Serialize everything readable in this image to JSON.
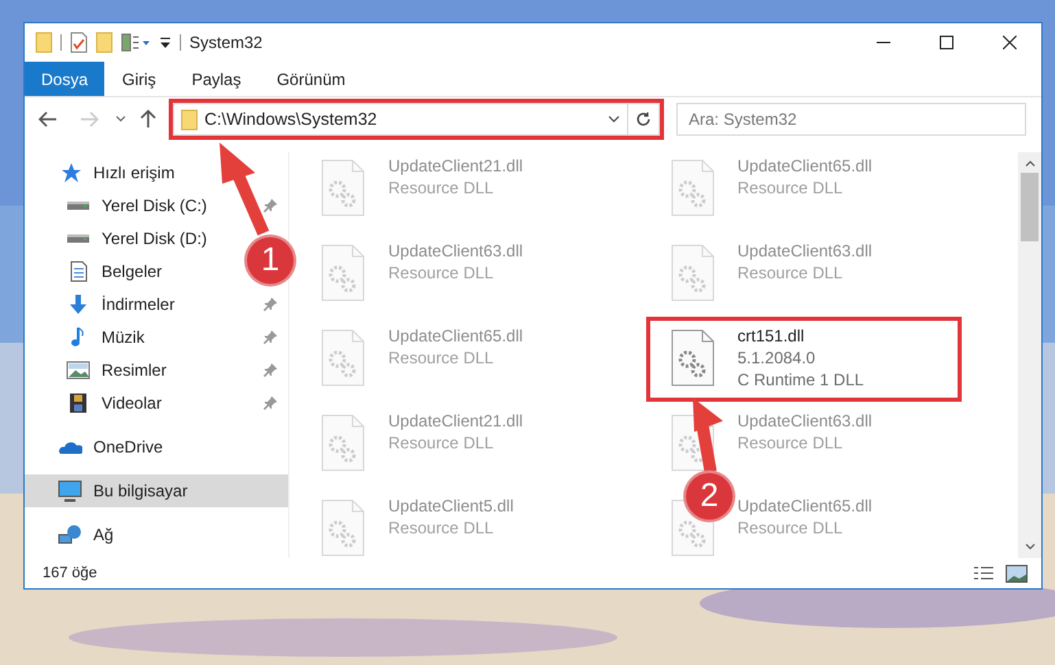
{
  "window": {
    "title": "System32"
  },
  "ribbon_tabs": [
    {
      "label": "Dosya",
      "selected": true
    },
    {
      "label": "Giriş",
      "selected": false
    },
    {
      "label": "Paylaş",
      "selected": false
    },
    {
      "label": "Görünüm",
      "selected": false
    }
  ],
  "address": {
    "value": "C:\\Windows\\System32"
  },
  "search": {
    "placeholder": "Ara: System32"
  },
  "sidebar": {
    "items": [
      {
        "label": "Hızlı erişim",
        "kind": "quick",
        "selected": false,
        "children": [
          {
            "label": "Yerel Disk (C:)",
            "kind": "disk",
            "pinned": true,
            "selected": false
          },
          {
            "label": "Yerel Disk (D:)",
            "kind": "disk",
            "pinned": false,
            "selected": false
          },
          {
            "label": "Belgeler",
            "kind": "docs",
            "pinned": false,
            "selected": false
          },
          {
            "label": "İndirmeler",
            "kind": "download",
            "pinned": true,
            "selected": false
          },
          {
            "label": "Müzik",
            "kind": "music",
            "pinned": true,
            "selected": false
          },
          {
            "label": "Resimler",
            "kind": "pictures",
            "pinned": true,
            "selected": false
          },
          {
            "label": "Videolar",
            "kind": "videos",
            "pinned": true,
            "selected": false
          }
        ]
      },
      {
        "label": "OneDrive",
        "kind": "cloud",
        "selected": false
      },
      {
        "label": "Bu bilgisayar",
        "kind": "pc",
        "selected": true
      },
      {
        "label": "Ağ",
        "kind": "network",
        "selected": false
      }
    ]
  },
  "files": [
    {
      "name": "UpdateClient21.dll",
      "lines": [
        "Resource DLL"
      ],
      "dimmed": true
    },
    {
      "name": "UpdateClient65.dll",
      "lines": [
        "Resource DLL"
      ],
      "dimmed": true
    },
    {
      "name": "UpdateClient63.dll",
      "lines": [
        "Resource DLL"
      ],
      "dimmed": true
    },
    {
      "name": "UpdateClient63.dll",
      "lines": [
        "Resource DLL"
      ],
      "dimmed": true
    },
    {
      "name": "UpdateClient65.dll",
      "lines": [
        "Resource DLL"
      ],
      "dimmed": true
    },
    {
      "name": "crt151.dll",
      "lines": [
        "5.1.2084.0",
        "C Runtime 1 DLL"
      ],
      "dimmed": false
    },
    {
      "name": "UpdateClient21.dll",
      "lines": [
        "Resource DLL"
      ],
      "dimmed": true
    },
    {
      "name": "UpdateClient63.dll",
      "lines": [
        "Resource DLL"
      ],
      "dimmed": true
    },
    {
      "name": "UpdateClient5.dll",
      "lines": [
        "Resource DLL"
      ],
      "dimmed": true
    },
    {
      "name": "UpdateClient65.dll",
      "lines": [
        "Resource DLL"
      ],
      "dimmed": true
    }
  ],
  "status_bar": {
    "count": "167 öğe"
  },
  "annotations": [
    {
      "number": "1"
    },
    {
      "number": "2"
    }
  ]
}
